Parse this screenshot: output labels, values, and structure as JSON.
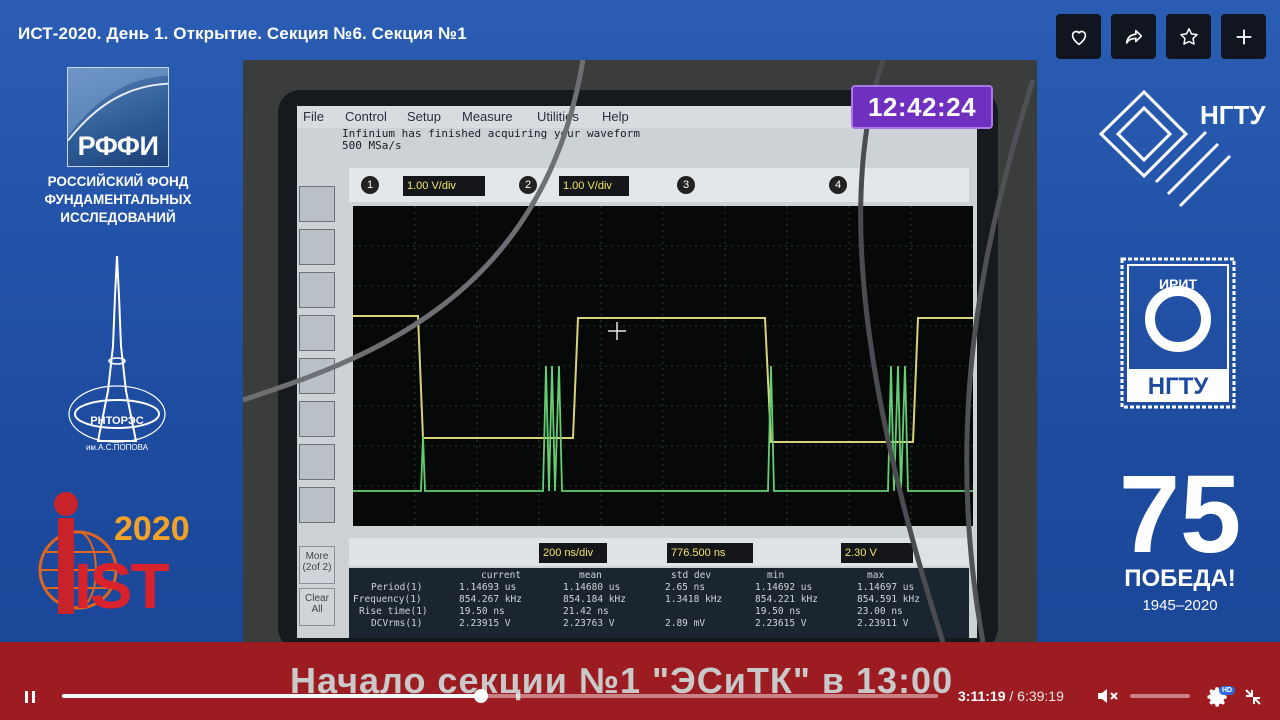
{
  "header": {
    "title": "ИСТ-2020. День 1. Открытие. Секция №6. Секция №1",
    "buttons": [
      "heart-icon",
      "share-icon",
      "star-icon",
      "plus-icon"
    ]
  },
  "left_logos": {
    "rffi_word": "РФФИ",
    "rffi_name_lines": [
      "РОССИЙСКИЙ ФОНД",
      "ФУНДАМЕНТАЛЬНЫХ",
      "ИССЛЕДОВАНИЙ"
    ],
    "rntores_word": "РНТОРЭС",
    "rntores_sub": "им.А.С.ПОПОВА",
    "ist_year": "2020",
    "ist_word": "IST"
  },
  "right_logos": {
    "ngtu_top": "НГТУ",
    "irit_word": "ИРИТ",
    "irit_ngtu": "НГТУ",
    "pobeda_num": "75",
    "pobeda_word": "ПОБЕДА!",
    "pobeda_years": "1945–2020"
  },
  "video": {
    "clock": "12:42:24",
    "scope": {
      "menu": [
        "File",
        "Control",
        "Setup",
        "Measure",
        "Utilities",
        "Help"
      ],
      "status_line1": "Infinium has finished acquiring your waveform",
      "status_line2": "500 MSa/s",
      "ch1_scale": "1.00 V/div",
      "ch2_scale": "1.00 V/div",
      "ch_labels": [
        "1",
        "2",
        "3",
        "4"
      ],
      "timebase": "200 ns/div",
      "delay": "776.500 ns",
      "trigger": "2.30 V",
      "more_label": "More (2of 2)",
      "clear_label": "Clear All",
      "measure_headers": [
        "current",
        "mean",
        "std dev",
        "min",
        "max"
      ],
      "measure_rows": [
        {
          "name": "Period(1)",
          "vals": [
            "1.14693 us",
            "1.14680 us",
            "2.65 ns",
            "1.14692 us",
            "1.14697 us"
          ]
        },
        {
          "name": "Frequency(1)",
          "vals": [
            "854.267 kHz",
            "854.184 kHz",
            "1.3418 kHz",
            "854.221 kHz",
            "854.591 kHz"
          ]
        },
        {
          "name": "Rise time(1)",
          "vals": [
            "19.50 ns",
            "21.42 ns",
            "",
            "19.50 ns",
            "23.00 ns"
          ]
        },
        {
          "name": "DCVrms(1)",
          "vals": [
            "2.23915 V",
            "2.23763 V",
            "2.89 mV",
            "2.23615 V",
            "2.23911 V"
          ]
        }
      ]
    }
  },
  "banner": {
    "text": "Начало секции №1 \"ЭСиТК\" в 13:00"
  },
  "player": {
    "current_time": "3:11:19",
    "separator": " / ",
    "total_time": "6:39:19",
    "progress": 0.478,
    "volume": 0,
    "hd_badge": "HD",
    "icons": [
      "pause-icon",
      "mute-icon",
      "settings-icon",
      "fullscreen-exit-icon"
    ]
  }
}
